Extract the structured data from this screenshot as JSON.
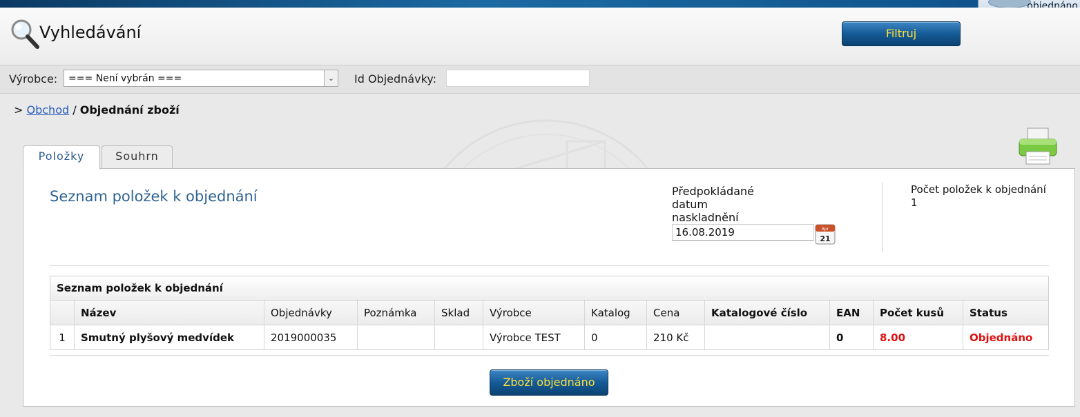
{
  "corner": {
    "label": "objednáno"
  },
  "header": {
    "title": "Vyhledávání",
    "filter_button": "Filtruj"
  },
  "filters": {
    "manufacturer_label": "Výrobce:",
    "manufacturer_value": "=== Není vybrán ===",
    "order_id_label": "Id Objednávky:",
    "order_id_value": ""
  },
  "breadcrumb": {
    "prefix": ">",
    "link": "Obchod",
    "separator": "/",
    "current": "Objednání zboží"
  },
  "tabs": [
    {
      "label": "Položky",
      "active": true
    },
    {
      "label": "Souhrn",
      "active": false
    }
  ],
  "panel": {
    "title": "Seznam položek k objednání",
    "date_label_lines": [
      "Předpokládané",
      "datum",
      "naskladnění"
    ],
    "date_value": "16.08.2019",
    "calendar": {
      "month": "Apr",
      "day": "21"
    },
    "count_label": "Počet položek k objednání",
    "count_value": "1"
  },
  "grid": {
    "caption": "Seznam položek k objednání",
    "columns": [
      "",
      "Název",
      "Objednávky",
      "Poznámka",
      "Sklad",
      "Výrobce",
      "Katalog",
      "Cena",
      "Katalogové číslo",
      "EAN",
      "Počet kusů",
      "Status"
    ],
    "rows": [
      [
        "1",
        "Smutný plyšový medvídek",
        "2019000035",
        "",
        "",
        "Výrobce TEST",
        "0",
        "210 Kč",
        "",
        "0",
        "8.00",
        "Objednáno"
      ]
    ]
  },
  "actions": {
    "ordered_button": "Zboží objednáno"
  },
  "colors": {
    "accent_blue": "#155b96",
    "button_text": "#ffe23a",
    "status_red": "#e01010",
    "title_blue": "#2f6394"
  }
}
